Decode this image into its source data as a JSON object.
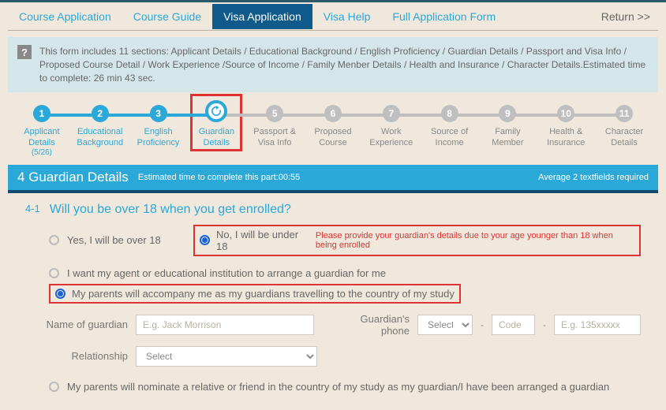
{
  "tabs": {
    "course_app": "Course Application",
    "course_guide": "Course Guide",
    "visa_app": "Visa Application",
    "visa_help": "Visa Help",
    "full_form": "Full Application Form",
    "return": "Return >>"
  },
  "info": {
    "text": "This form includes 11 sections: Applicant Details / Educational Background / English Proficiency / Guardian Details / Passport and Visa Info / Proposed Course Detail / Work Experience /Source of Income / Family Menber Details / Health and Insurance / Character Details.Estimated time to complete: 26 min 43 sec."
  },
  "steps": [
    {
      "num": "1",
      "label": "Applicant Details",
      "sub": "(5/26)"
    },
    {
      "num": "2",
      "label": "Educational Background"
    },
    {
      "num": "3",
      "label": "English Proficiency"
    },
    {
      "num": "4",
      "label": "Guardian Details"
    },
    {
      "num": "5",
      "label": "Passport & Visa Info"
    },
    {
      "num": "6",
      "label": "Proposed Course"
    },
    {
      "num": "7",
      "label": "Work Experience"
    },
    {
      "num": "8",
      "label": "Source of Income"
    },
    {
      "num": "9",
      "label": "Family Member"
    },
    {
      "num": "10",
      "label": "Health & Insurance"
    },
    {
      "num": "11",
      "label": "Character Details"
    }
  ],
  "section": {
    "title": "4 Guardian Details",
    "est": "Estimated time to complete this part:00:55",
    "avg": "Average 2 textfields required"
  },
  "q41": {
    "num": "4-1",
    "text": "Will you be over 18 when you get enrolled?",
    "opt_yes": "Yes, I will be over 18",
    "opt_no": "No, I will be under 18",
    "warn": "Please provide your guardian's details due to your age younger than 18 when being enrolled",
    "sub_agent": "I want my agent or educational institution to arrange a guardian for me",
    "sub_parents": "My parents will accompany me as my guardians travelling to the country of my study",
    "sub_nominate": "My parents will nominate a relative or friend in the country of my study as my guardian/I have been arranged a guardian"
  },
  "form": {
    "name_label": "Name of guardian",
    "name_ph": "E.g. Jack Morrison",
    "phone_label": "Guardian's phone",
    "phone_sel": "Select",
    "phone_code_ph": "Code",
    "phone_num_ph": "E.g. 135xxxxx",
    "rel_label": "Relationship",
    "rel_ph": "Select"
  }
}
